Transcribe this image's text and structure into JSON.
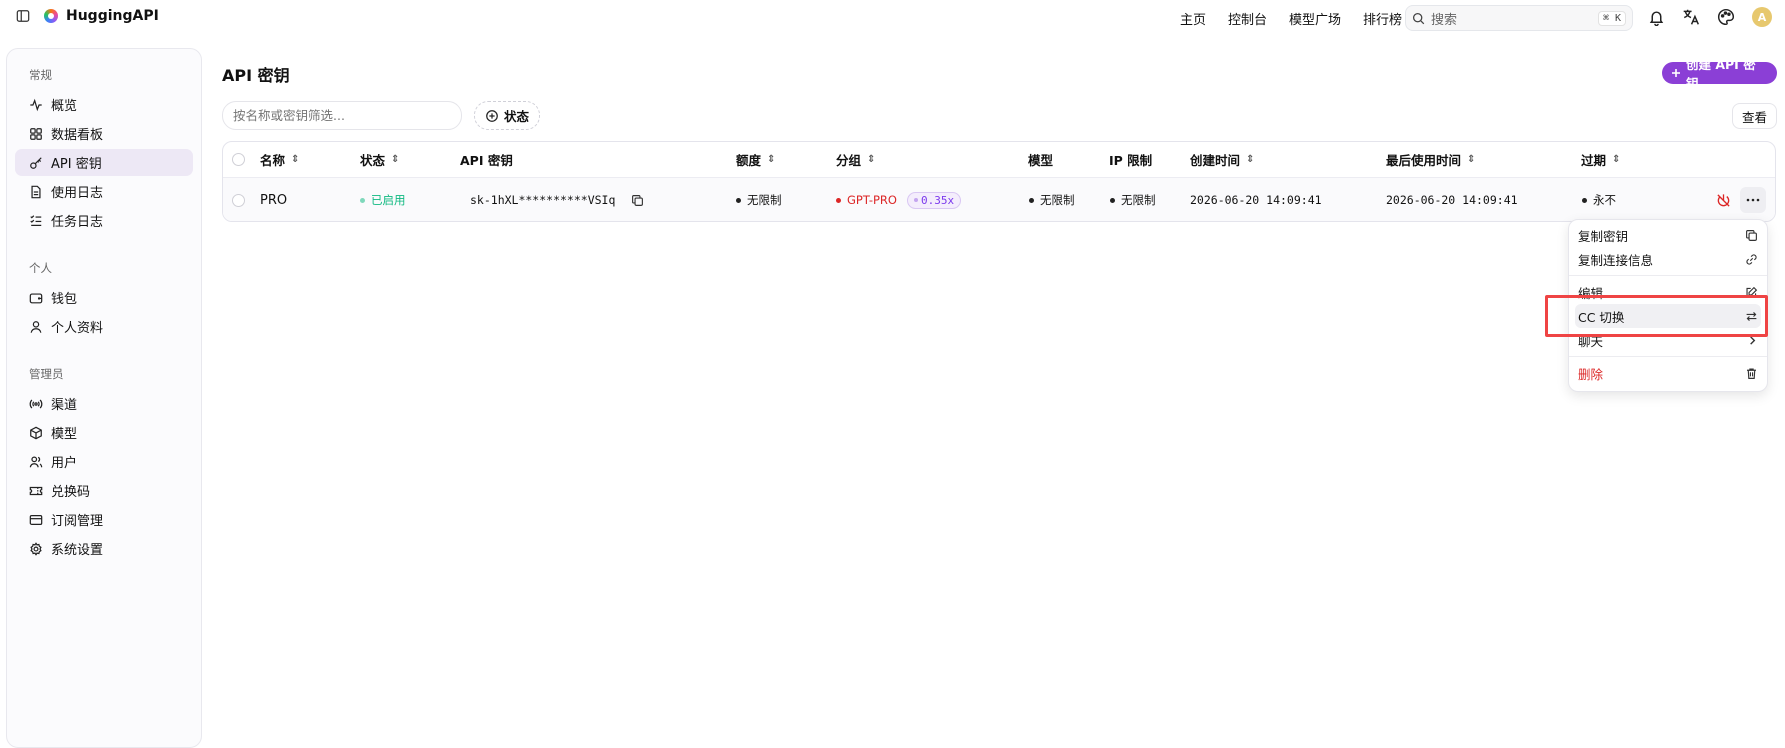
{
  "app": {
    "name": "HuggingAPI"
  },
  "nav": [
    {
      "label": "主页"
    },
    {
      "label": "控制台"
    },
    {
      "label": "模型广场"
    },
    {
      "label": "排行榜"
    }
  ],
  "search": {
    "placeholder": "搜索",
    "shortcut": "⌘ K"
  },
  "user": {
    "avatar_letter": "A"
  },
  "sidebar": {
    "groups": [
      {
        "label": "常规",
        "items": [
          {
            "label": "概览",
            "icon": "activity-icon"
          },
          {
            "label": "数据看板",
            "icon": "dashboard-icon"
          },
          {
            "label": "API 密钥",
            "icon": "key-icon",
            "active": true
          },
          {
            "label": "使用日志",
            "icon": "log-icon"
          },
          {
            "label": "任务日志",
            "icon": "task-list-icon"
          }
        ]
      },
      {
        "label": "个人",
        "items": [
          {
            "label": "钱包",
            "icon": "wallet-icon"
          },
          {
            "label": "个人资料",
            "icon": "user-icon"
          }
        ]
      },
      {
        "label": "管理员",
        "items": [
          {
            "label": "渠道",
            "icon": "broadcast-icon"
          },
          {
            "label": "模型",
            "icon": "cube-icon"
          },
          {
            "label": "用户",
            "icon": "users-icon"
          },
          {
            "label": "兑换码",
            "icon": "ticket-icon"
          },
          {
            "label": "订阅管理",
            "icon": "card-icon"
          },
          {
            "label": "系统设置",
            "icon": "settings-icon"
          }
        ]
      }
    ]
  },
  "page": {
    "title": "API 密钥",
    "create_label": "创建 API 密钥",
    "filter_placeholder": "按名称或密钥筛选...",
    "status_filter_label": "状态",
    "view_label": "查看"
  },
  "table": {
    "columns": [
      "名称",
      "状态",
      "API 密钥",
      "额度",
      "分组",
      "模型",
      "IP 限制",
      "创建时间",
      "最后使用时间",
      "过期"
    ],
    "rows": [
      {
        "name": "PRO",
        "status": "已启用",
        "key": "sk-1hXL**********VSIq",
        "quota": "无限制",
        "group": "GPT-PRO",
        "ratio": "0.35x",
        "model": "无限制",
        "ip_limit": "无限制",
        "created": "2026-06-20 14:09:41",
        "last_used": "2026-06-20 14:09:41",
        "expires": "永不"
      }
    ]
  },
  "menu": {
    "items": [
      {
        "label": "复制密钥",
        "icon": "copy-icon"
      },
      {
        "label": "复制连接信息",
        "icon": "link-icon"
      },
      {
        "label": "编辑",
        "icon": "edit-icon"
      },
      {
        "label": "CC 切换",
        "icon": "switch-icon"
      },
      {
        "label": "聊天",
        "icon": "chevron-right-icon"
      },
      {
        "label": "删除",
        "icon": "trash-icon"
      }
    ]
  },
  "colors": {
    "accent": "#8b3fd6",
    "status_green": "#10b981",
    "danger": "#dc2626",
    "group_red": "#dc2626",
    "highlight_border": "#ef4444"
  }
}
